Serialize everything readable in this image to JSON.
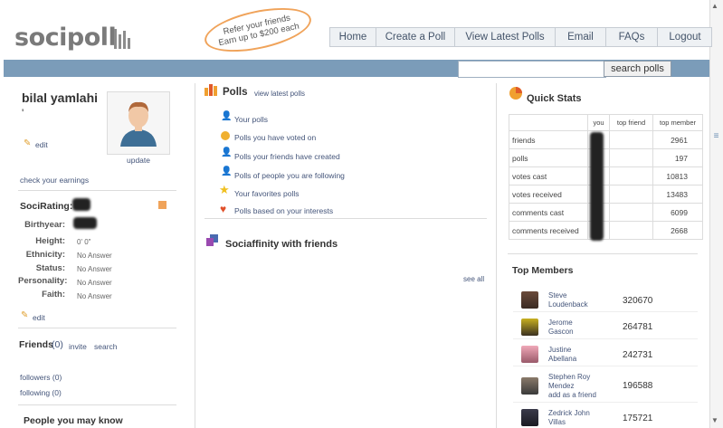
{
  "header": {
    "logo": "socipoll",
    "refer_line1": "Refer your friends",
    "refer_line2": "Earn up to $200 each",
    "nav": [
      "Home",
      "Create a Poll",
      "View Latest Polls",
      "Email",
      "FAQs",
      "Logout"
    ],
    "search_placeholder": "",
    "search_button": "search polls"
  },
  "profile": {
    "name": "bilal yamlahi",
    "tick": "'",
    "edit_label": "edit",
    "update_label": "update",
    "earnings_link": "check your earnings",
    "socirating_label": "SociRating:",
    "fields": [
      {
        "label": "Birthyear:",
        "value": ""
      },
      {
        "label": "Height:",
        "value": "0' 0\""
      },
      {
        "label": "Ethnicity:",
        "value": "No Answer"
      },
      {
        "label": "Status:",
        "value": "No Answer"
      },
      {
        "label": "Personality:",
        "value": "No Answer"
      },
      {
        "label": "Faith:",
        "value": "No Answer"
      }
    ],
    "edit2_label": "edit",
    "friends_label": "Friends",
    "friends_count": "(0)",
    "invite_label": "invite",
    "search_label": "search",
    "followers": "followers (0)",
    "following": "following (0)",
    "people_title": "People you may know"
  },
  "polls": {
    "title": "Polls",
    "view_latest": "view latest polls",
    "items": [
      {
        "icon": "person-icon",
        "label": "Your polls"
      },
      {
        "icon": "vote-icon",
        "label": "Polls you have voted on"
      },
      {
        "icon": "friends-icon",
        "label": "Polls your friends have created"
      },
      {
        "icon": "following-icon",
        "label": "Polls of people you are following"
      },
      {
        "icon": "star-icon",
        "label": "Your favorites polls"
      },
      {
        "icon": "heart-icon",
        "label": "Polls based on your interests"
      }
    ],
    "sociaffinity_title": "Sociaffinity with friends",
    "see_all": "see all"
  },
  "quick_stats": {
    "title": "Quick Stats",
    "headers": [
      "",
      "you",
      "top friend",
      "top member"
    ],
    "rows": [
      {
        "label": "friends",
        "top_member": "2961"
      },
      {
        "label": "polls",
        "top_member": "197"
      },
      {
        "label": "votes cast",
        "top_member": "10813"
      },
      {
        "label": "votes received",
        "top_member": "13483"
      },
      {
        "label": "comments cast",
        "top_member": "6099"
      },
      {
        "label": "comments received",
        "top_member": "2668"
      }
    ]
  },
  "top_members": {
    "title": "Top Members",
    "members": [
      {
        "name_line1": "Steve",
        "name_line2": "Loudenback",
        "score": "320670"
      },
      {
        "name_line1": "Jerome",
        "name_line2": "Gascon",
        "score": "264781"
      },
      {
        "name_line1": "Justine",
        "name_line2": "Abellana",
        "score": "242731"
      },
      {
        "name_line1": "Stephen Roy",
        "name_line2": "Mendez",
        "extra": "add as a friend",
        "score": "196588"
      },
      {
        "name_line1": "Zedrick John",
        "name_line2": "Villas",
        "score": "175721"
      }
    ]
  },
  "colors": {
    "accent_blue": "#7b9cb9",
    "link": "#44557a",
    "orange": "#f0a35a"
  }
}
